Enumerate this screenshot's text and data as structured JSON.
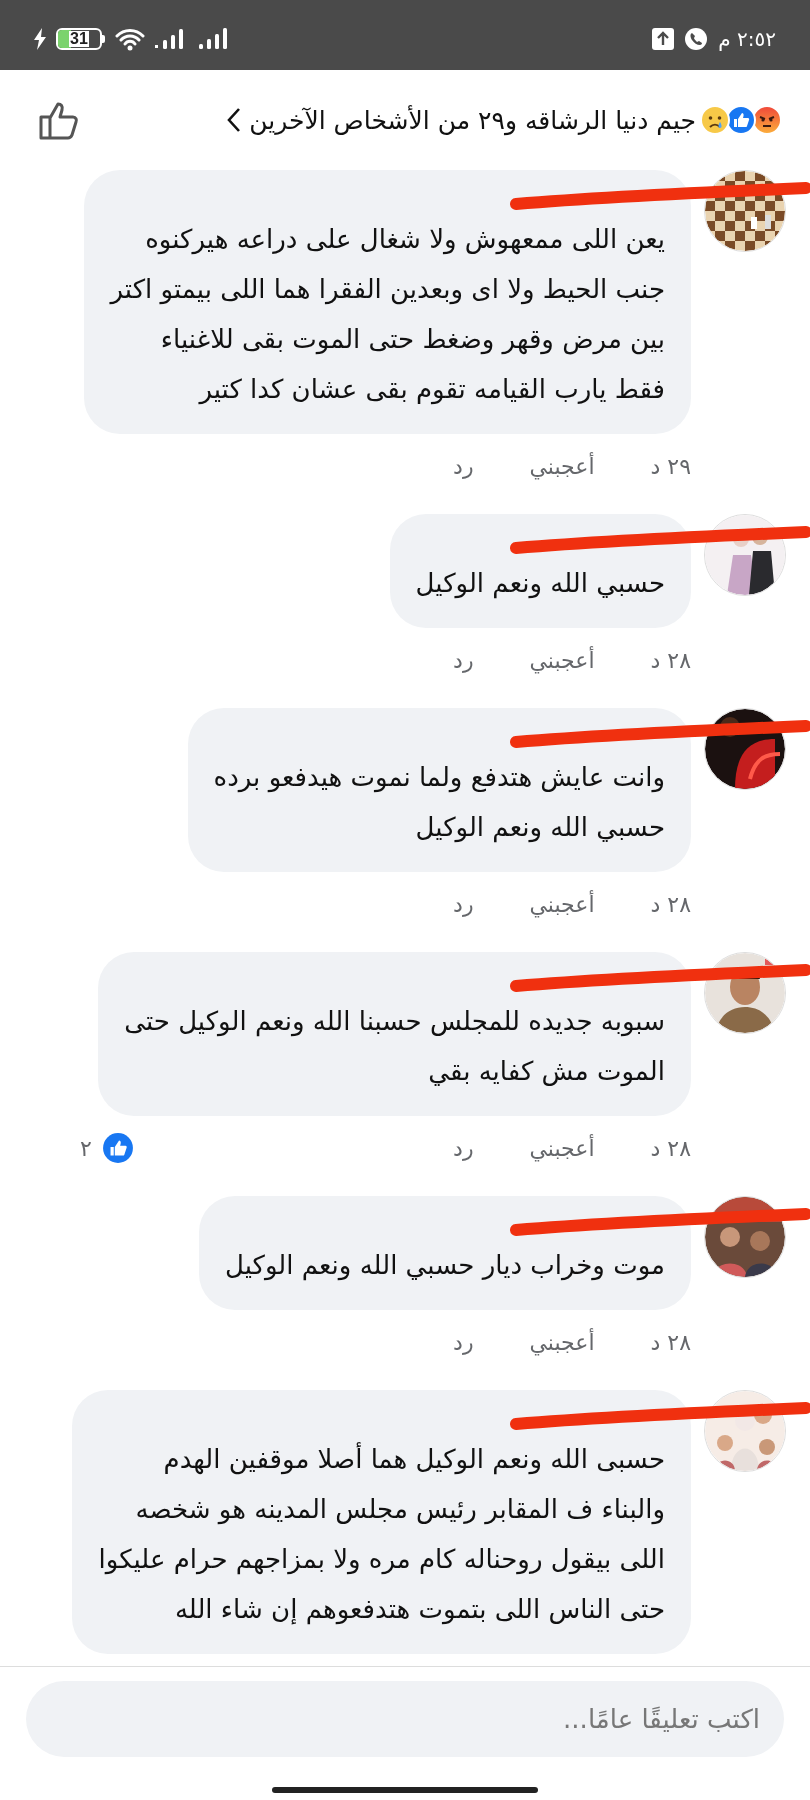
{
  "status_bar": {
    "time": "٢:٥٢ م",
    "battery": "31"
  },
  "header": {
    "title": "جيم دنيا الرشاقه و٢٩ من الأشخاص الآخرين",
    "reactions": [
      {
        "kind": "angry"
      },
      {
        "kind": "like"
      },
      {
        "kind": "sad"
      }
    ]
  },
  "comments": [
    {
      "redacted": true,
      "text": "يعن اللى ممعهوش ولا شغال على دراعه  هيركنوه\nجنب الحيط ولا اى  وبعدين الفقرا هما اللى بيمتو اكتر\nبين مرض وقهر وضغط  حتى الموت بقى للاغنياء\nفقط يارب القيامه تقوم بقى عشان كدا كتير",
      "time": "٢٩ د",
      "like": "أعجبني",
      "reply": "رد"
    },
    {
      "redacted": true,
      "text": "حسبي الله ونعم الوكيل",
      "time": "٢٨ د",
      "like": "أعجبني",
      "reply": "رد"
    },
    {
      "redacted": true,
      "text": "وانت عايش هتدفع ولما نموت هيدفعو برده\nحسبي الله ونعم الوكيل",
      "time": "٢٨ د",
      "like": "أعجبني",
      "reply": "رد"
    },
    {
      "redacted": true,
      "text": "سبوبه جديده للمجلس حسبنا الله ونعم الوكيل حتى\nالموت مش كفايه بقي",
      "time": "٢٨ د",
      "like": "أعجبني",
      "reply": "رد",
      "reaction_count": "٢"
    },
    {
      "redacted": true,
      "text": "موت وخراب ديار حسبي الله ونعم الوكيل",
      "time": "٢٨ د",
      "like": "أعجبني",
      "reply": "رد"
    },
    {
      "redacted": true,
      "text": "حسبى الله ونعم الوكيل هما أصلا موقفين الهدم\nوالبناء ف المقابر رئيس مجلس المدينه هو شخصه\nاللى بيقول روحناله كام مره ولا بمزاجهم حرام عليكوا\nحتى الناس اللى بتموت هتدفعوهم إن شاء الله"
    }
  ],
  "composer": {
    "placeholder": "اكتب تعليقًا عامًا..."
  }
}
